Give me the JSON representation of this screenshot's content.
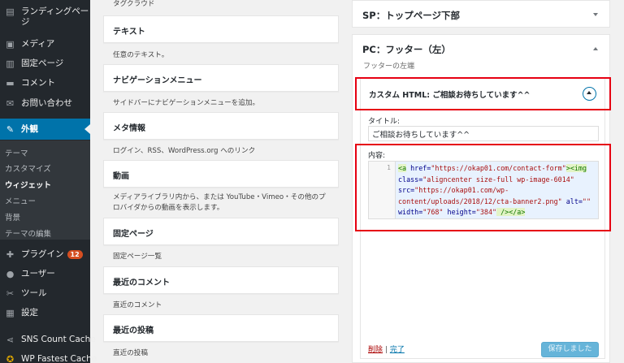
{
  "sidebar": {
    "items": [
      {
        "icon": "landing-page-icon",
        "label": "ランディングページ"
      },
      {
        "icon": "media-icon",
        "label": "メディア"
      },
      {
        "icon": "page-icon",
        "label": "固定ページ"
      },
      {
        "icon": "comment-icon",
        "label": "コメント"
      },
      {
        "icon": "mail-icon",
        "label": "お問い合わせ"
      },
      {
        "icon": "appearance-icon",
        "label": "外観"
      },
      {
        "icon": "plugin-icon",
        "label": "プラグイン",
        "badge": "12"
      },
      {
        "icon": "user-icon",
        "label": "ユーザー"
      },
      {
        "icon": "tool-icon",
        "label": "ツール"
      },
      {
        "icon": "settings-icon",
        "label": "設定"
      },
      {
        "icon": "share-icon",
        "label": "SNS Count Cache"
      },
      {
        "icon": "cache-icon",
        "label": "WP Fastest Cache"
      }
    ],
    "submenu": [
      "テーマ",
      "カスタマイズ",
      "ウィジェット",
      "メニュー",
      "背景",
      "テーマの編集"
    ],
    "current_submenu": "ウィジェット"
  },
  "widgets": {
    "top_desc": "タグクラウド",
    "list": [
      {
        "title": "テキスト",
        "desc": "任意のテキスト。"
      },
      {
        "title": "ナビゲーションメニュー",
        "desc": "サイドバーにナビゲーションメニューを追加。"
      },
      {
        "title": "メタ情報",
        "desc": "ログイン、RSS、WordPress.org へのリンク"
      },
      {
        "title": "動画",
        "desc": "メディアライブラリ内から、または YouTube・Vimeo・その他のプロバイダからの動画を表示します。"
      },
      {
        "title": "固定ページ",
        "desc": "固定ページ一覧"
      },
      {
        "title": "最近のコメント",
        "desc": "直近のコメント"
      },
      {
        "title": "最近の投稿",
        "desc": "直近の投稿"
      }
    ]
  },
  "panel": {
    "area1_title": "SP：トップページ下部",
    "area2_title": "PC：フッター（左）",
    "area2_desc": "フッターの左端",
    "widget_title": "カスタム HTML: ご相談お待ちしています^^",
    "title_label": "タイトル:",
    "title_value": "ご相談お待ちしています^^",
    "content_label": "内容:",
    "line_number": "1",
    "code": {
      "l1_tag_open": "<a",
      "l1_attr": " href=",
      "l1_val": "\"https://okap01.com/contact-form\"",
      "l1_tag_close": ">",
      "l1_img": "<img",
      "l2_attr": "class=",
      "l2_val": "\"aligncenter size-full wp-image-6014\"",
      "l3_attr": "src=",
      "l3_val": "\"https://okap01.com/wp-",
      "l4_val": "content/uploads/2018/12/cta-banner2.png\"",
      "l4_attr": " alt=",
      "l4_val2": "\"\"",
      "l5_attr1": "width=",
      "l5_val1": "\"768\"",
      "l5_attr2": " height=",
      "l5_val2": "\"384\"",
      "l5_end": " />",
      "l5_close": "</a>"
    },
    "delete_label": "削除",
    "separator": "|",
    "done_label": "完了",
    "save_label": "保存しました"
  },
  "colors": {
    "sidebar_bg": "#23282d",
    "accent": "#0073aa",
    "highlight": "#e60012"
  }
}
